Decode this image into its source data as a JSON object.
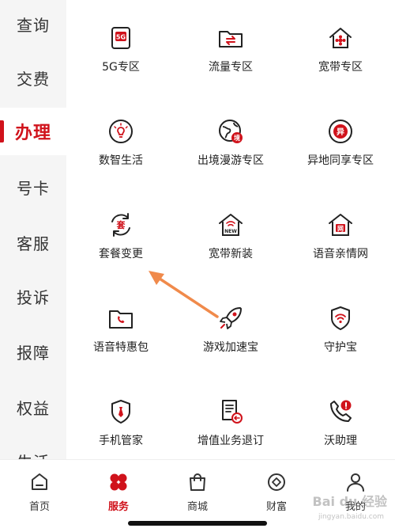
{
  "sidebar": {
    "items": [
      {
        "label": "查询"
      },
      {
        "label": "交费"
      },
      {
        "label": "办理",
        "active": true
      },
      {
        "label": "号卡"
      },
      {
        "label": "客服"
      },
      {
        "label": "投诉"
      },
      {
        "label": "报障"
      },
      {
        "label": "权益"
      },
      {
        "label": "生活"
      }
    ]
  },
  "grid": {
    "items": [
      {
        "label": "5G专区",
        "icon": "5g-icon",
        "badge": "5G"
      },
      {
        "label": "流量专区",
        "icon": "data-folder-icon"
      },
      {
        "label": "宽带专区",
        "icon": "broadband-house-icon"
      },
      {
        "label": "数智生活",
        "icon": "lightbulb-icon"
      },
      {
        "label": "出境漫游专区",
        "icon": "globe-roaming-icon",
        "badge": "境"
      },
      {
        "label": "异地同享专区",
        "icon": "remote-share-icon",
        "badge": "异"
      },
      {
        "label": "套餐变更",
        "icon": "plan-change-icon",
        "badge": "套"
      },
      {
        "label": "宽带新装",
        "icon": "new-broadband-icon",
        "badge": "NEW"
      },
      {
        "label": "语音亲情网",
        "icon": "family-network-icon",
        "badge": "网"
      },
      {
        "label": "语音特惠包",
        "icon": "voice-package-icon"
      },
      {
        "label": "游戏加速宝",
        "icon": "rocket-icon"
      },
      {
        "label": "守护宝",
        "icon": "guard-shield-icon"
      },
      {
        "label": "手机管家",
        "icon": "phone-manager-icon"
      },
      {
        "label": "增值业务退订",
        "icon": "unsubscribe-icon"
      },
      {
        "label": "沃助理",
        "icon": "assistant-phone-icon"
      }
    ]
  },
  "bottom_nav": {
    "items": [
      {
        "label": "首页",
        "icon": "home-icon"
      },
      {
        "label": "服务",
        "icon": "service-icon",
        "active": true
      },
      {
        "label": "商城",
        "icon": "shop-bag-icon"
      },
      {
        "label": "财富",
        "icon": "wealth-icon"
      },
      {
        "label": "我的",
        "icon": "user-icon"
      }
    ]
  },
  "colors": {
    "accent": "#d0121b",
    "annotation_arrow": "#f08a4b"
  },
  "watermark": {
    "text": "Bai du 经验",
    "sub": "jingyan.baidu.com"
  }
}
